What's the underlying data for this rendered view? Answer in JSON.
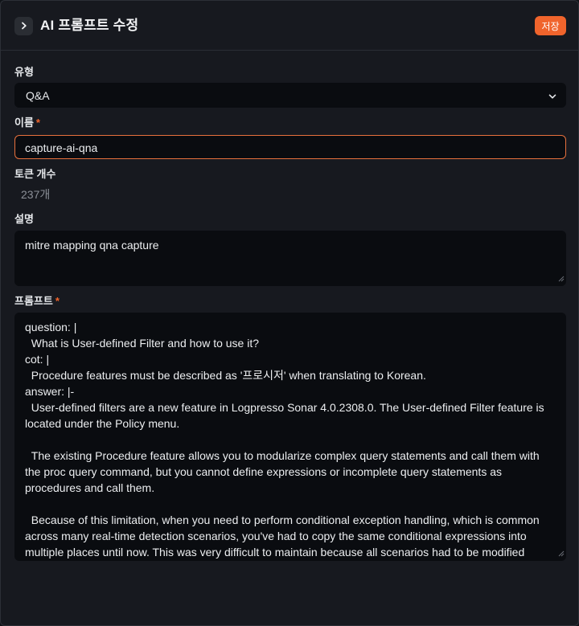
{
  "header": {
    "title": "AI 프롬프트 수정",
    "save_label": "저장"
  },
  "form": {
    "type": {
      "label": "유형",
      "value": "Q&A"
    },
    "name": {
      "label": "이름",
      "required_mark": "*",
      "value": "capture-ai-qna"
    },
    "tokens": {
      "label": "토큰 개수",
      "value": "237개"
    },
    "description": {
      "label": "설명",
      "value": "mitre mapping qna capture"
    },
    "prompt": {
      "label": "프롬프트",
      "required_mark": "*",
      "value": "question: |\n  What is User-defined Filter and how to use it?\ncot: |\n  Procedure features must be described as '프로시저' when translating to Korean.\nanswer: |-\n  User-defined filters are a new feature in Logpresso Sonar 4.0.2308.0. The User-defined Filter feature is located under the Policy menu.\n\n  The existing Procedure feature allows you to modularize complex query statements and call them with the proc query command, but you cannot define expressions or incomplete query statements as procedures and call them.\n\n  Because of this limitation, when you need to perform conditional exception handling, which is common across many real-time detection scenarios, you've had to copy the same conditional expressions into multiple places until now. This was very difficult to maintain because all scenarios had to be modified"
    }
  },
  "colors": {
    "accent": "#f0642c",
    "panel_bg": "#17191f",
    "field_bg": "#0a0c10"
  },
  "icons": {
    "toggle": "chevron-right-icon",
    "select": "chevron-down-icon",
    "resize": "resize-grip-icon"
  }
}
